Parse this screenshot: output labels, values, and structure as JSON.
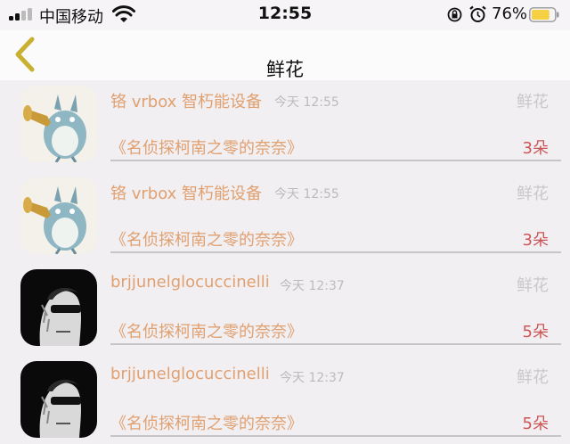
{
  "status_bar": {
    "carrier": "中国移动",
    "time": "12:55",
    "battery_percent": "76%",
    "battery_level": 0.76,
    "battery_color": "#f5d042",
    "signal_bars": 2,
    "icons": [
      "signal-icon",
      "wifi-icon",
      "orientation-lock-icon",
      "alarm-clock-icon",
      "battery-icon"
    ]
  },
  "nav": {
    "title": "鲜花",
    "back_icon": "chevron-left-icon",
    "back_color": "#c9b030"
  },
  "colors": {
    "accent_text": "#e0a070",
    "count_text": "#cc5555",
    "muted_text": "#bbbbbb"
  },
  "items": [
    {
      "avatar": "totoro-trumpet-avatar",
      "sender": "铬 vrbox 智朽能设备",
      "time": "今天 12:55",
      "type": "鲜花",
      "book": "《名侦探柯南之零的奈奈》",
      "count": "3朵"
    },
    {
      "avatar": "totoro-trumpet-avatar",
      "sender": "铬 vrbox 智朽能设备",
      "time": "今天 12:55",
      "type": "鲜花",
      "book": "《名侦探柯南之零的奈奈》",
      "count": "3朵"
    },
    {
      "avatar": "sunglasses-man-avatar",
      "sender": "brjjunelglocuccinelli",
      "time": "今天 12:37",
      "type": "鲜花",
      "book": "《名侦探柯南之零的奈奈》",
      "count": "5朵"
    },
    {
      "avatar": "sunglasses-man-avatar",
      "sender": "brjjunelglocuccinelli",
      "time": "今天 12:37",
      "type": "鲜花",
      "book": "《名侦探柯南之零的奈奈》",
      "count": "5朵"
    }
  ]
}
